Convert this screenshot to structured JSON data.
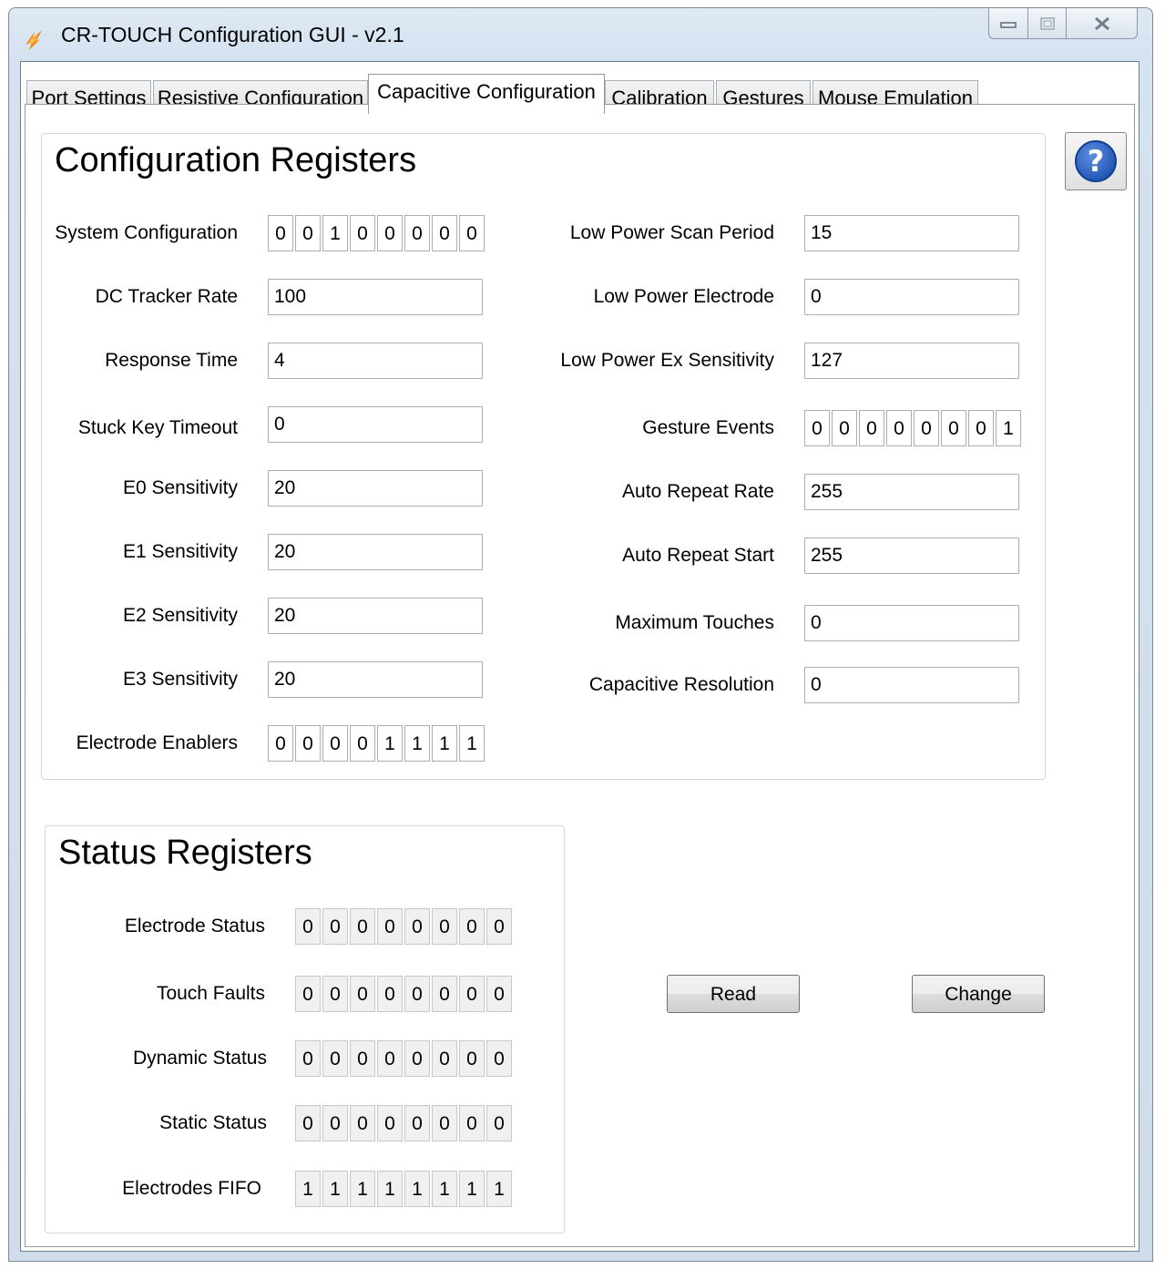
{
  "window": {
    "title": "CR-TOUCH Configuration GUI - v2.1"
  },
  "tabs": [
    "Port Settings",
    "Resistive Configuration",
    "Capacitive Configuration",
    "Calibration",
    "Gestures",
    "Mouse Emulation"
  ],
  "active_tab": "Capacitive Configuration",
  "help": {
    "icon": "help-question-icon",
    "glyph": "?"
  },
  "config": {
    "title": "Configuration Registers",
    "left": [
      {
        "label": "System Configuration",
        "bits": [
          "0",
          "0",
          "1",
          "0",
          "0",
          "0",
          "0",
          "0"
        ]
      },
      {
        "label": "DC Tracker Rate",
        "value": "100"
      },
      {
        "label": "Response Time",
        "value": "4"
      },
      {
        "label": "Stuck Key Timeout",
        "value": "0"
      },
      {
        "label": "E0 Sensitivity",
        "value": "20"
      },
      {
        "label": "E1 Sensitivity",
        "value": "20"
      },
      {
        "label": "E2 Sensitivity",
        "value": "20"
      },
      {
        "label": "E3 Sensitivity",
        "value": "20"
      },
      {
        "label": "Electrode Enablers",
        "bits": [
          "0",
          "0",
          "0",
          "0",
          "1",
          "1",
          "1",
          "1"
        ]
      }
    ],
    "right": [
      {
        "label": "Low Power Scan Period",
        "value": "15"
      },
      {
        "label": "Low Power Electrode",
        "value": "0"
      },
      {
        "label": "Low Power Ex Sensitivity",
        "value": "127"
      },
      {
        "label": "Gesture Events",
        "bits": [
          "0",
          "0",
          "0",
          "0",
          "0",
          "0",
          "0",
          "1"
        ]
      },
      {
        "label": "Auto Repeat Rate",
        "value": "255"
      },
      {
        "label": "Auto Repeat Start",
        "value": "255"
      },
      {
        "label": "Maximum Touches",
        "value": "0"
      },
      {
        "label": "Capacitive Resolution",
        "value": "0"
      }
    ]
  },
  "status": {
    "title": "Status Registers",
    "rows": [
      {
        "label": "Electrode Status",
        "bits": [
          "0",
          "0",
          "0",
          "0",
          "0",
          "0",
          "0",
          "0"
        ]
      },
      {
        "label": "Touch Faults",
        "bits": [
          "0",
          "0",
          "0",
          "0",
          "0",
          "0",
          "0",
          "0"
        ]
      },
      {
        "label": "Dynamic Status",
        "bits": [
          "0",
          "0",
          "0",
          "0",
          "0",
          "0",
          "0",
          "0"
        ]
      },
      {
        "label": "Static Status",
        "bits": [
          "0",
          "0",
          "0",
          "0",
          "0",
          "0",
          "0",
          "0"
        ]
      },
      {
        "label": "Electrodes FIFO",
        "bits": [
          "1",
          "1",
          "1",
          "1",
          "1",
          "1",
          "1",
          "1"
        ]
      }
    ]
  },
  "buttons": {
    "read": "Read",
    "change": "Change"
  },
  "colors": {
    "help_blue": "#1f55b5",
    "window_frame": "#cfdcea"
  }
}
